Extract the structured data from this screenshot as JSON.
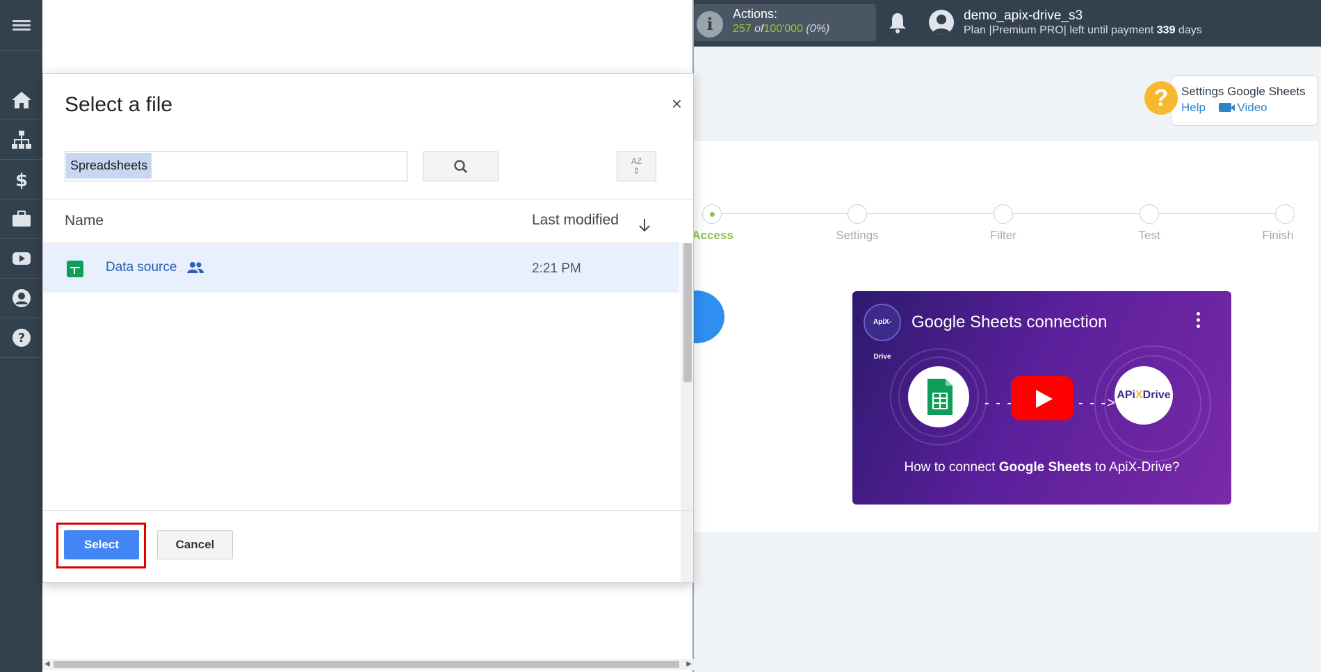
{
  "header": {
    "actions_label": "Actions:",
    "actions_used": "257",
    "actions_of": "of",
    "actions_total": "100'000",
    "actions_pct": "(0%)",
    "username": "demo_apix-drive_s3",
    "plan_prefix": "Plan |Premium PRO| left until payment",
    "plan_days": "339",
    "plan_suffix": "days"
  },
  "sidebar": {
    "items": [
      {
        "icon": "home-icon"
      },
      {
        "icon": "sitemap-icon"
      },
      {
        "icon": "dollar-icon"
      },
      {
        "icon": "briefcase-icon"
      },
      {
        "icon": "youtube-icon"
      },
      {
        "icon": "user-icon"
      },
      {
        "icon": "help-icon"
      }
    ]
  },
  "help": {
    "title": "Settings Google Sheets",
    "help_link": "Help",
    "video_link": "Video"
  },
  "steps": [
    {
      "label": "Access",
      "active": true
    },
    {
      "label": "Settings",
      "active": false
    },
    {
      "label": "Filter",
      "active": false
    },
    {
      "label": "Test",
      "active": false
    },
    {
      "label": "Finish",
      "active": false
    }
  ],
  "video": {
    "title": "Google Sheets connection",
    "logo_text": "ApiX-Drive",
    "caption_pre": "How to connect",
    "caption_bold": "Google Sheets",
    "caption_post": "to ApiX-Drive?",
    "brand_a": "APi",
    "brand_x": "X",
    "brand_b": "Drive"
  },
  "dialog": {
    "title": "Select a file",
    "close": "×",
    "search_value": "Spreadsheets",
    "sort_label": "AZ",
    "col_name": "Name",
    "col_modified": "Last modified",
    "files": [
      {
        "name": "Data source",
        "modified": "2:21 PM",
        "shared": true
      }
    ],
    "select_label": "Select",
    "cancel_label": "Cancel"
  }
}
